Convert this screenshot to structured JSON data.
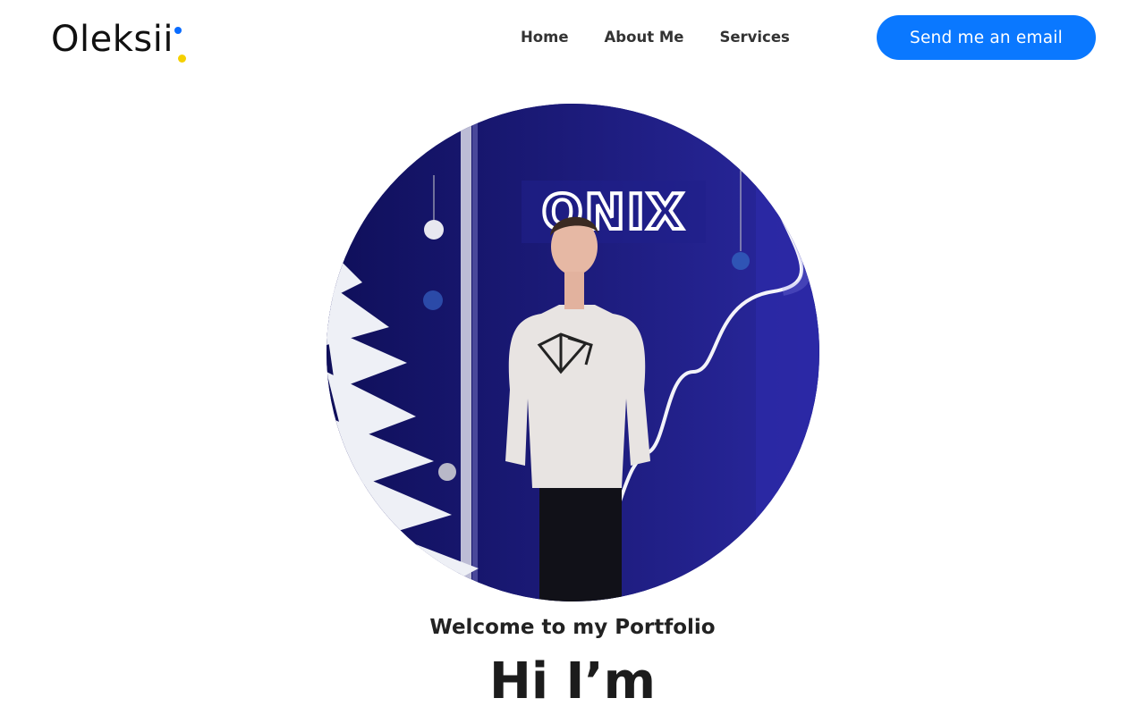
{
  "header": {
    "logo_text": "Oleksii",
    "logo_colors": {
      "dot_blue": "#0a6cff",
      "dot_yellow": "#f5d000"
    },
    "nav": [
      {
        "label": "Home"
      },
      {
        "label": "About Me"
      },
      {
        "label": "Services"
      }
    ],
    "cta_label": "Send me an email",
    "cta_color": "#0a78ff"
  },
  "hero": {
    "photo_sign_text": "ONIX",
    "welcome": "Welcome to my Portfolio",
    "heading": "Hi I’m"
  },
  "theme": {
    "backdrop": "#1b1a78",
    "neon": "#ffffff"
  }
}
